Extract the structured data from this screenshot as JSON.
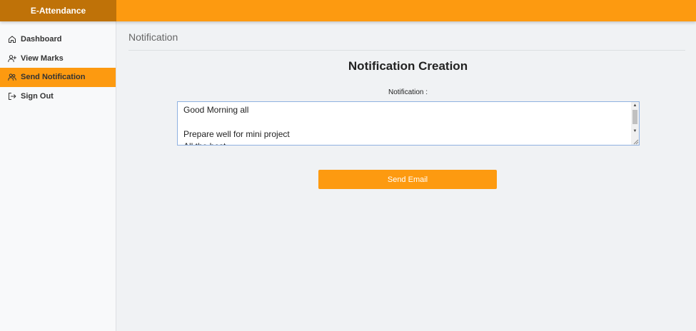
{
  "app": {
    "brand": "E-Attendance"
  },
  "colors": {
    "accent": "#fd9a10",
    "brand_bg": "#bf7208"
  },
  "sidebar": {
    "items": [
      {
        "label": "Dashboard",
        "icon": "home-icon",
        "active": false
      },
      {
        "label": "View Marks",
        "icon": "user-plus-icon",
        "active": false
      },
      {
        "label": "Send Notification",
        "icon": "users-icon",
        "active": true
      },
      {
        "label": "Sign Out",
        "icon": "sign-out-icon",
        "active": false
      }
    ]
  },
  "page": {
    "title": "Notification"
  },
  "form": {
    "heading": "Notification Creation",
    "label": "Notification :",
    "notification_value": "Good Morning all\n\nPrepare well for mini project\nAll the best",
    "submit_label": "Send Email"
  }
}
